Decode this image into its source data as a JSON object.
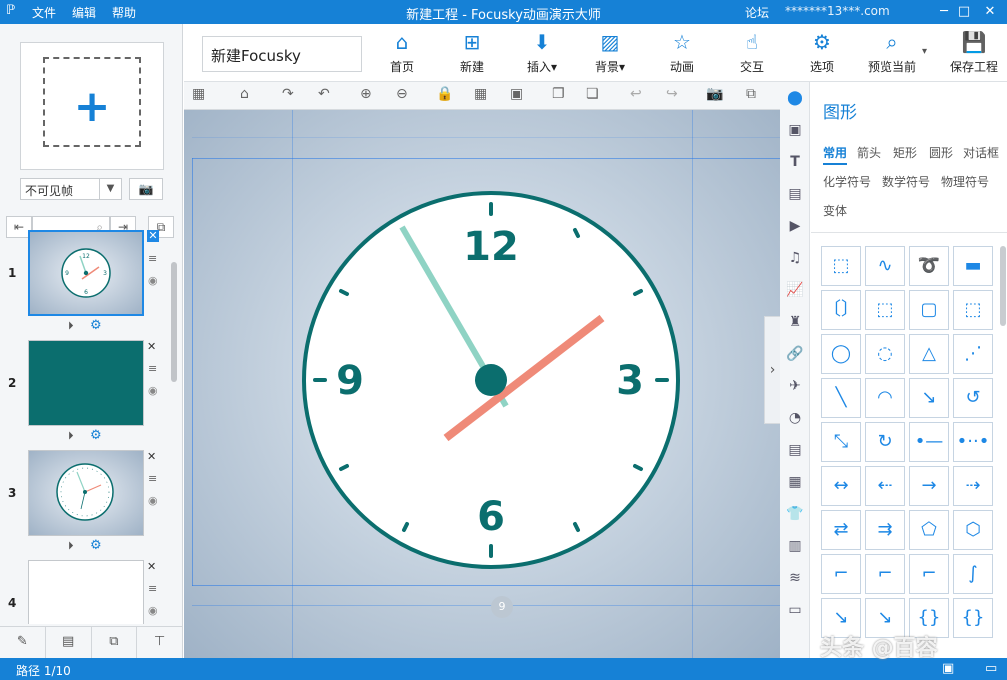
{
  "titlebar": {
    "logo": "ℙ",
    "menu": [
      "文件",
      "编辑",
      "帮助"
    ],
    "title": "新建工程 - Focusky动画演示大师",
    "forum": "论坛",
    "email": "*******13***.com",
    "btn_min": "─",
    "btn_max": "□",
    "btn_close": "✕"
  },
  "left": {
    "add_frame_plus": "+",
    "frame_select": "不可见帧",
    "select_arrow": "▼",
    "camera": "📷",
    "slides": [
      {
        "num": "1",
        "kind": "clock"
      },
      {
        "num": "2",
        "kind": "teal"
      },
      {
        "num": "3",
        "kind": "clock2"
      },
      {
        "num": "4",
        "kind": "blank"
      }
    ],
    "slide_icons": {
      "close": "✕",
      "menu": "≡",
      "eye": "◉",
      "play": "⏵",
      "gear": "⚙"
    },
    "bottom_tools": [
      "✎",
      "▤",
      "⧉",
      "⊤"
    ]
  },
  "toolbar": {
    "project_name": "新建Focusky",
    "tools": [
      {
        "label": "首页",
        "icon": "⌂"
      },
      {
        "label": "新建",
        "icon": "⊞"
      },
      {
        "label": "插入▾",
        "icon": "⬇"
      },
      {
        "label": "背景▾",
        "icon": "▨"
      },
      {
        "label": "动画",
        "icon": "☆"
      },
      {
        "label": "交互",
        "icon": "☝"
      },
      {
        "label": "选项",
        "icon": "⚙"
      },
      {
        "label": "预览当前",
        "icon": "⌕"
      },
      {
        "label": "保存工程",
        "icon": "💾"
      }
    ],
    "preview_arrow": "▾"
  },
  "subtoolbar_icons": [
    "▦",
    "⌂",
    "↷",
    "↶",
    "⊕",
    "⊖",
    "🔒",
    "▦",
    "▣",
    "❐",
    "❏",
    "↩",
    "↪",
    "📷",
    "⧉"
  ],
  "canvas": {
    "frame_badge": "9",
    "collapse_arrow": "›"
  },
  "clock": {
    "numbers": [
      "12",
      "3",
      "6",
      "9"
    ],
    "colors": {
      "rim": "#0b6e6e",
      "face": "#ffffff",
      "minute_hand": "#8fd3c4",
      "hour_hand": "#ef8a78",
      "hub": "#0b6e6e"
    }
  },
  "side_icons": [
    "⬤",
    "▣",
    "T",
    "▤",
    "▶",
    "♫",
    "📈",
    "♜",
    "🔗",
    "✈",
    "◔",
    "▤",
    "▦",
    "👕",
    "▥",
    "≋",
    "▭"
  ],
  "shapes": {
    "title": "图形",
    "tabs": [
      "常用",
      "箭头",
      "矩形",
      "圆形",
      "对话框",
      "化学符号",
      "数学符号",
      "物理符号",
      "变体"
    ],
    "cells": [
      "⬚",
      "∿",
      "➰",
      "▬",
      "〔〕",
      "⬚",
      "▢",
      "⬚",
      "◯",
      "◌",
      "△",
      "⋰",
      "╲",
      "◠",
      "↘",
      "↺",
      "⤡",
      "↻",
      "•—•",
      "•··•",
      "↔",
      "⇠",
      "→",
      "⇢",
      "⇄",
      "⇉",
      "⬠",
      "⬡",
      "⌐",
      "⌐",
      "⌐",
      "∫",
      "↘",
      "↘",
      "{}",
      "{}"
    ]
  },
  "status": {
    "path": "路径 1/10",
    "icon1": "▣",
    "icon2": "▭",
    "watermark": "头条 @百容"
  }
}
